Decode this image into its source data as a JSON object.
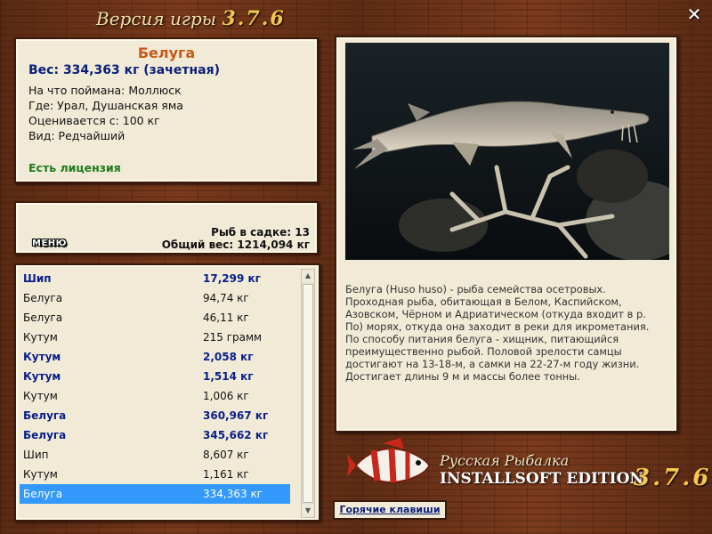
{
  "window": {
    "title_prefix": "Версия игры",
    "title_version": "3.7.6"
  },
  "fish_info": {
    "name": "Белуга",
    "weight": "Вес: 334,363 кг (зачетная)",
    "bait": "На что поймана: Моллюск",
    "place": "Где: Урал, Душанская яма",
    "rated_from": "Оценивается с: 100 кг",
    "rarity": "Вид: Редчайший",
    "license": "Есть лицензия"
  },
  "cage": {
    "menu_label": "МЕНЮ",
    "fish_count": "Рыб в садке: 13",
    "total_weight": "Общий вес: 1214,094 кг"
  },
  "catch_list": [
    {
      "name": "Шип",
      "weight": "17,299 кг",
      "style": "big"
    },
    {
      "name": "Белуга",
      "weight": "94,74 кг",
      "style": "normal"
    },
    {
      "name": "Белуга",
      "weight": "46,11 кг",
      "style": "normal"
    },
    {
      "name": "Кутум",
      "weight": "215 грамм",
      "style": "normal"
    },
    {
      "name": "Кутум",
      "weight": "2,058 кг",
      "style": "big"
    },
    {
      "name": "Кутум",
      "weight": "1,514 кг",
      "style": "big"
    },
    {
      "name": "Кутум",
      "weight": "1,006 кг",
      "style": "normal"
    },
    {
      "name": "Белуга",
      "weight": "360,967 кг",
      "style": "big"
    },
    {
      "name": "Белуга",
      "weight": "345,662 кг",
      "style": "big"
    },
    {
      "name": "Шип",
      "weight": "8,607 кг",
      "style": "normal"
    },
    {
      "name": "Кутум",
      "weight": "1,161 кг",
      "style": "normal"
    },
    {
      "name": "Белуга",
      "weight": "334,363 кг",
      "style": "selected"
    }
  ],
  "description": "Белуга (Huso huso) - рыба семейства осетровых. Проходная рыба, обитающая в Белом, Каспийском, Азовском, Чёрном и Адриатическом (откуда входит в р. По) морях, откуда она заходит в реки для икрометания. По способу питания белуга - хищник, питающийся преимущественно рыбой. Половой зрелости самцы достигают на 13-18-м, а самки на 22-27-м году жизни. Достигает длины 9 м и массы более тонны.",
  "brand": {
    "line1": "Русская Рыбалка",
    "line2": "INSTALLSOFT EDITION",
    "version": "3.7.6"
  },
  "hotkeys_label": "Горячие клавиши",
  "colors": {
    "accent_name": "#c85a1a",
    "weight_blue": "#0a1f7a",
    "license_green": "#1f7a1f",
    "selection": "#3399ff",
    "panel_bg": "#f1ead6"
  }
}
